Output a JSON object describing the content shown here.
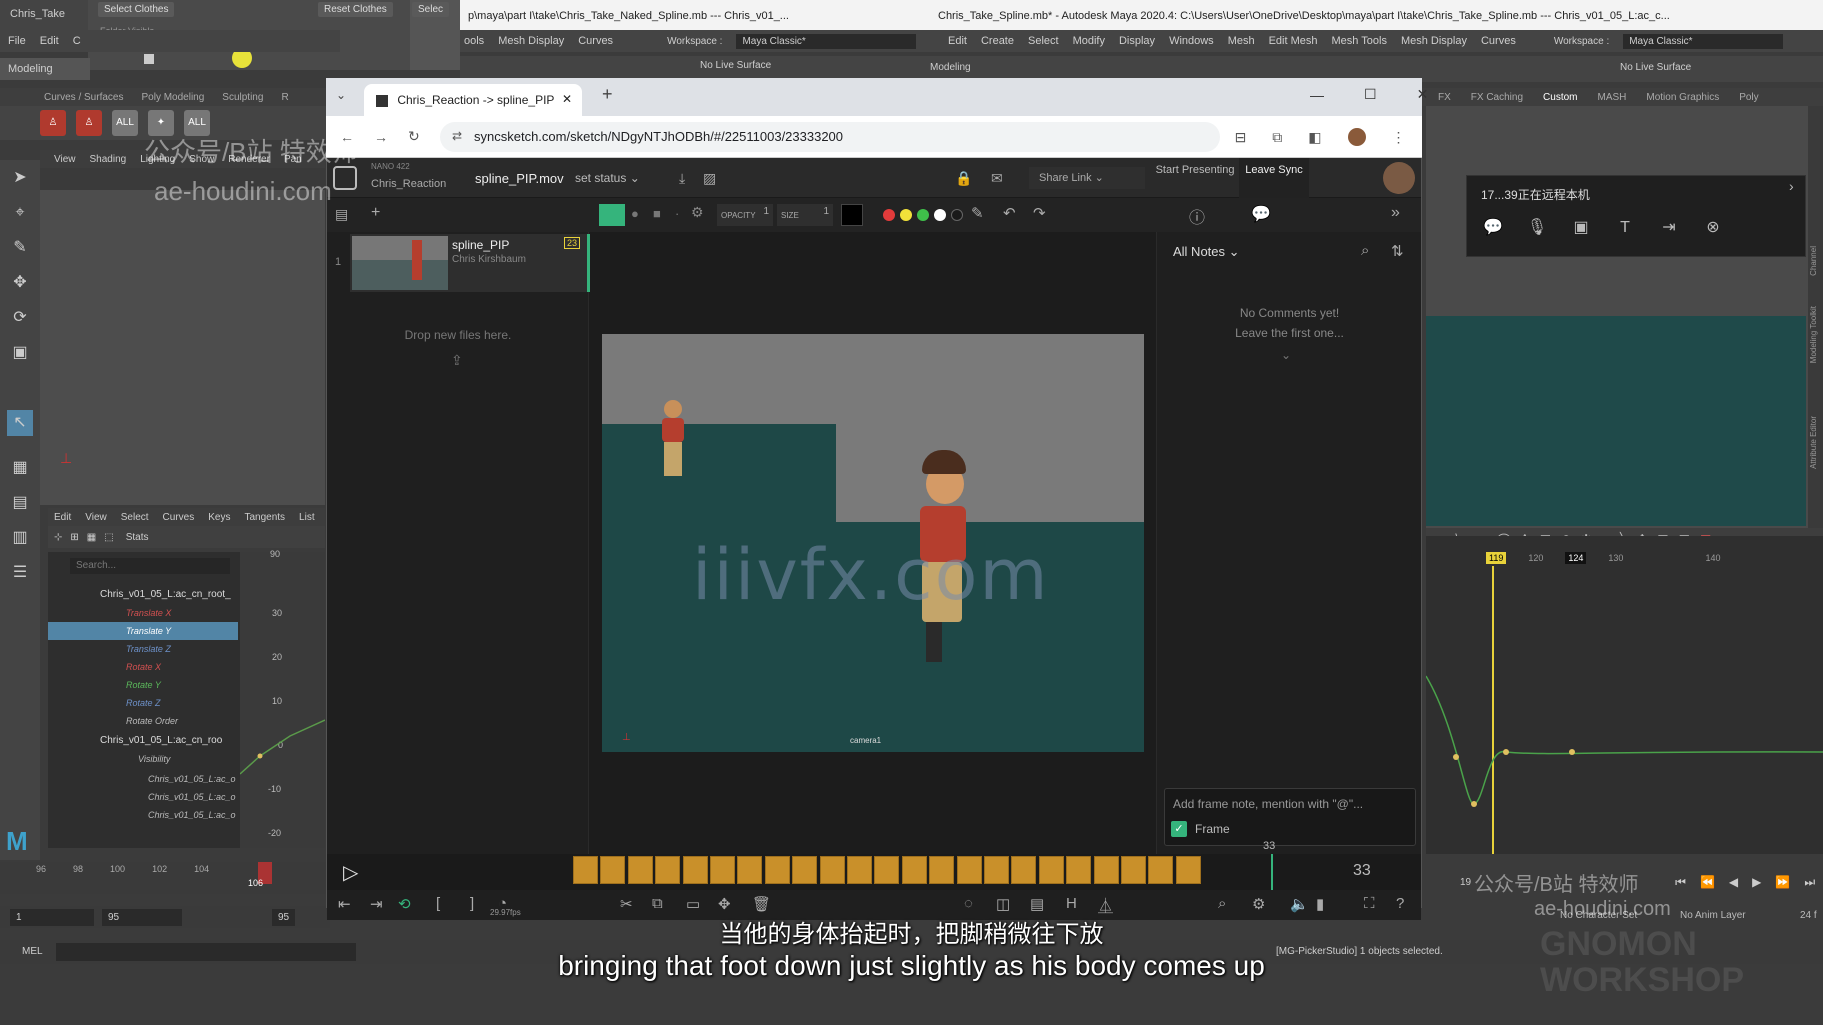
{
  "maya_left": {
    "title": "Chris_Take",
    "menu": [
      "File",
      "Edit",
      "C"
    ],
    "mode": "Modeling",
    "attr_buttons": [
      "Select Clothes",
      "Reset Clothes",
      "Selec"
    ],
    "attr_label": "Folder Visible",
    "shelf_tabs": [
      "Curves / Surfaces",
      "Poly Modeling",
      "Sculpting",
      "R"
    ],
    "shelf_icons": [
      "ALL",
      "ALL"
    ],
    "viewport_menu": [
      "View",
      "Shading",
      "Lighting",
      "Show",
      "Renderer",
      "Pan"
    ],
    "graph_menu": [
      "Edit",
      "View",
      "Select",
      "Curves",
      "Keys",
      "Tangents",
      "List"
    ],
    "graph_stats": "Stats",
    "search_placeholder": "Search...",
    "outliner": {
      "root1": "Chris_v01_05_L:ac_cn_root_",
      "items": [
        {
          "label": "Translate X",
          "color": "red"
        },
        {
          "label": "Translate Y",
          "color": "sel"
        },
        {
          "label": "Translate Z",
          "color": "blue"
        },
        {
          "label": "Rotate X",
          "color": "red"
        },
        {
          "label": "Rotate Y",
          "color": "green"
        },
        {
          "label": "Rotate Z",
          "color": "blue"
        },
        {
          "label": "Rotate Order",
          "color": ""
        }
      ],
      "root2": "Chris_v01_05_L:ac_cn_roo",
      "visibility": "Visibility",
      "sub_items": [
        "Chris_v01_05_L:ac_o",
        "Chris_v01_05_L:ac_o",
        "Chris_v01_05_L:ac_o"
      ]
    },
    "graph_values": [
      "30",
      "20",
      "10",
      "0",
      "-10",
      "-20"
    ],
    "graph_top": "90",
    "timeline_ticks": [
      "96",
      "98",
      "100",
      "102",
      "104",
      "106"
    ],
    "current_frame": "106",
    "range_start": "1",
    "range_current": "95",
    "range_end": "95",
    "mel_label": "MEL"
  },
  "maya_mid": {
    "title": "p\\maya\\part I\\take\\Chris_Take_Naked_Spline.mb  ---  Chris_v01_...",
    "menu": [
      "ools",
      "Mesh Display",
      "Curves"
    ],
    "workspace_label": "Workspace :",
    "workspace_value": "Maya Classic*",
    "live_surface": "No Live Surface"
  },
  "maya_right": {
    "title": "Chris_Take_Spline.mb* - Autodesk Maya 2020.4: C:\\Users\\User\\OneDrive\\Desktop\\maya\\part I\\take\\Chris_Take_Spline.mb  ---  Chris_v01_05_L:ac_c...",
    "menu": [
      "Edit",
      "Create",
      "Select",
      "Modify",
      "Display",
      "Windows",
      "Mesh",
      "Edit Mesh",
      "Mesh Tools",
      "Mesh Display",
      "Curves"
    ],
    "workspace_label": "Workspace :",
    "workspace_value": "Maya Classic*",
    "mode": "Modeling",
    "live_surface": "No Live Surface",
    "shelf_tabs": [
      "FX",
      "FX Caching",
      "Custom",
      "MASH",
      "Motion Graphics",
      "Poly"
    ],
    "remote_title": "17...39正在远程本机",
    "graph_frames": [
      "119",
      "120",
      "124",
      "130",
      "140"
    ],
    "side_labels": [
      "Channel",
      "Modeling Toolkit",
      "Attribute Editor"
    ],
    "frame_right": "19",
    "no_character_set": "No Character Set",
    "no_anim_layer": "No Anim Layer",
    "fps_right": "24 f",
    "status": "[MG-PickerStudio] 1 objects selected."
  },
  "browser": {
    "tab_title": "Chris_Reaction -> spline_PIP",
    "url": "syncsketch.com/sketch/NDgyNTJhODBh/#/22511003/23333200",
    "new_tab": "+"
  },
  "syncsketch": {
    "project_small": "NANO 422",
    "project": "Chris_Reaction",
    "file_name": "spline_PIP.mov",
    "status_label": "set status",
    "share_link": "Share Link",
    "start_presenting": "Start Presenting",
    "leave_sync": "Leave Sync",
    "opacity_label": "OPACITY",
    "opacity_value": "1",
    "size_label": "SIZE",
    "size_value": "1",
    "colors": [
      "#e23b3b",
      "#f1e13a",
      "#3fbf4a",
      "#ffffff",
      "#1a1a1a"
    ],
    "file_card": {
      "index": "1",
      "name": "spline_PIP",
      "author": "Chris Kirshbaum",
      "badge": "23"
    },
    "drop_text": "Drop new files here.",
    "notes_filter": "All Notes",
    "no_comments": "No Comments yet!",
    "leave_first": "Leave the first one...",
    "note_placeholder": "Add frame note, mention with \"@\"...",
    "frame_label": "Frame",
    "frame_marker": "33",
    "current_frame": "33",
    "fps": "29.97fps",
    "camera_label": "camera1"
  },
  "watermarks": {
    "center": "iiivfx.com",
    "top_left_1": "公众号/B站 特效师",
    "top_left_2": "ae-houdini.com",
    "bottom_right_1": "公众号/B站 特效师",
    "bottom_right_2": "ae-houdini.com",
    "gnomon": "GNOMON WORKSHOP"
  },
  "subtitles": {
    "cn": "当他的身体抬起时，把脚稍微往下放",
    "en": "bringing that foot down just slightly as his body comes up"
  }
}
